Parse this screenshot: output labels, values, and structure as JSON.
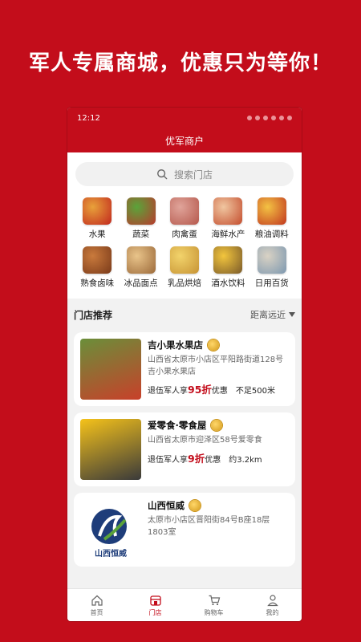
{
  "headline": "军人专属商城，优惠只为等你！",
  "status_bar": {
    "time": "12:12"
  },
  "app": {
    "title": "优军商户"
  },
  "search": {
    "placeholder": "搜索门店"
  },
  "categories": [
    {
      "label": "水果",
      "icon": "fruit-icon",
      "colors": [
        "#e8a13a",
        "#c2281e"
      ]
    },
    {
      "label": "蔬菜",
      "icon": "vegetable-icon",
      "colors": [
        "#5aa43a",
        "#b83b2d"
      ]
    },
    {
      "label": "肉禽蛋",
      "icon": "meat-icon",
      "colors": [
        "#e0a49a",
        "#b5584c"
      ]
    },
    {
      "label": "海鲜水产",
      "icon": "seafood-icon",
      "colors": [
        "#f0c6a0",
        "#c44d2e"
      ]
    },
    {
      "label": "粮油调料",
      "icon": "grain-oil-icon",
      "colors": [
        "#f3c243",
        "#c2381f"
      ]
    },
    {
      "label": "熟食卤味",
      "icon": "deli-icon",
      "colors": [
        "#c97a3c",
        "#7a3a1a"
      ]
    },
    {
      "label": "冰品面点",
      "icon": "dessert-icon",
      "colors": [
        "#e9c48a",
        "#9c6a3a"
      ]
    },
    {
      "label": "乳品烘焙",
      "icon": "bakery-icon",
      "colors": [
        "#f2d36b",
        "#c79334"
      ]
    },
    {
      "label": "酒水饮料",
      "icon": "drinks-icon",
      "colors": [
        "#f2c53d",
        "#7a5a2a"
      ]
    },
    {
      "label": "日用百货",
      "icon": "daily-goods-icon",
      "colors": [
        "#d9d2c4",
        "#7d98b0"
      ]
    }
  ],
  "stores_section": {
    "title": "门店推荐",
    "sort_label": "距离远近"
  },
  "stores": [
    {
      "name": "吉小果水果店",
      "address": "山西省太原市小店区平阳路街道128号吉小果水果店",
      "promo_prefix": "退伍军人享",
      "discount": "95折",
      "promo_suffix": "优惠",
      "distance": "不足500米",
      "thumb_colors": [
        "#6a8f3a",
        "#c8402a"
      ]
    },
    {
      "name": "爱零食·零食屋",
      "address": "山西省太原市迎泽区58号爱零食",
      "promo_prefix": "退伍军人享",
      "discount": "9折",
      "promo_suffix": "优惠",
      "distance": "约3.2km",
      "thumb_colors": [
        "#f5c21a",
        "#3a3a3a"
      ]
    },
    {
      "name": "山西恒威",
      "address": "太原市小店区晋阳街84号B座18层1803室",
      "logo_text": "山西恒威",
      "thumb_colors": [
        "#1e3d7a",
        "#5aa23a"
      ]
    }
  ],
  "tabbar": [
    {
      "label": "首页",
      "icon": "home-icon"
    },
    {
      "label": "门店",
      "icon": "store-icon"
    },
    {
      "label": "购物车",
      "icon": "cart-icon"
    },
    {
      "label": "我的",
      "icon": "profile-icon"
    }
  ],
  "colors": {
    "brand": "#c30d1b",
    "discount": "#c30d1b"
  }
}
